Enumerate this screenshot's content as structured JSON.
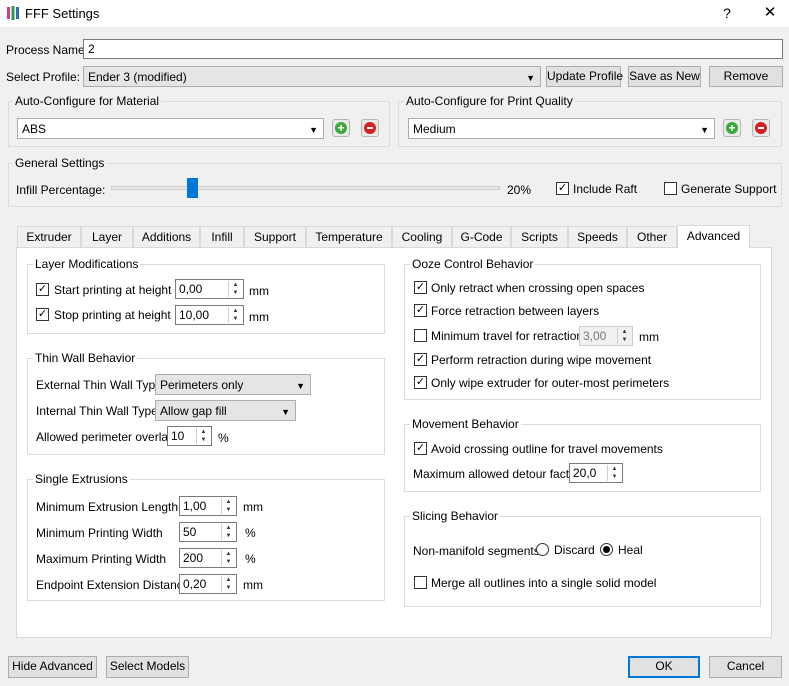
{
  "window": {
    "title": "FFF Settings",
    "help": "?",
    "close": "✕"
  },
  "process_name": {
    "label": "Process Name:",
    "value": "2"
  },
  "profile": {
    "label": "Select Profile:",
    "selected": "Ender 3 (modified)",
    "update_btn": "Update Profile",
    "save_btn": "Save as New",
    "remove_btn": "Remove"
  },
  "material": {
    "title": "Auto-Configure for Material",
    "selected": "ABS"
  },
  "quality": {
    "title": "Auto-Configure for Print Quality",
    "selected": "Medium"
  },
  "general": {
    "title": "General Settings",
    "infill_label": "Infill Percentage:",
    "infill_value": "20%",
    "infill_fraction": 0.2,
    "raft_label": "Include Raft",
    "raft_checked": true,
    "support_label": "Generate Support",
    "support_checked": false
  },
  "tabs": [
    "Extruder",
    "Layer",
    "Additions",
    "Infill",
    "Support",
    "Temperature",
    "Cooling",
    "G-Code",
    "Scripts",
    "Speeds",
    "Other",
    "Advanced"
  ],
  "active_tab": "Advanced",
  "layer_mods": {
    "title": "Layer Modifications",
    "start_label": "Start printing at height",
    "start_value": "0,00",
    "start_unit": "mm",
    "stop_label": "Stop printing at height",
    "stop_value": "10,00",
    "stop_unit": "mm"
  },
  "thin_wall": {
    "title": "Thin Wall Behavior",
    "external_label": "External Thin Wall Type",
    "external_value": "Perimeters only",
    "internal_label": "Internal Thin Wall Type",
    "internal_value": "Allow gap fill",
    "overlap_label": "Allowed perimeter overlap",
    "overlap_value": "10",
    "overlap_unit": "%"
  },
  "single_ext": {
    "title": "Single Extrusions",
    "rows": [
      {
        "label": "Minimum Extrusion Length",
        "value": "1,00",
        "unit": "mm"
      },
      {
        "label": "Minimum Printing Width",
        "value": "50",
        "unit": "%"
      },
      {
        "label": "Maximum Printing Width",
        "value": "200",
        "unit": "%"
      },
      {
        "label": "Endpoint Extension Distance",
        "value": "0,20",
        "unit": "mm"
      }
    ]
  },
  "ooze": {
    "title": "Ooze Control Behavior",
    "only_retract": "Only retract when crossing open spaces",
    "force_retract": "Force retraction between layers",
    "min_travel": "Minimum travel for retraction",
    "min_travel_value": "3,00",
    "min_travel_unit": "mm",
    "perform_retract": "Perform retraction during wipe movement",
    "only_wipe": "Only wipe extruder for outer-most perimeters"
  },
  "movement": {
    "title": "Movement Behavior",
    "avoid_label": "Avoid crossing outline for travel movements",
    "detour_label": "Maximum allowed detour factor",
    "detour_value": "20,0"
  },
  "slicing": {
    "title": "Slicing Behavior",
    "nonmanifold_label": "Non-manifold segments:",
    "discard": "Discard",
    "heal": "Heal",
    "merge_label": "Merge all outlines into a single solid model"
  },
  "footer": {
    "hide_advanced": "Hide Advanced",
    "select_models": "Select Models",
    "ok": "OK",
    "cancel": "Cancel"
  }
}
